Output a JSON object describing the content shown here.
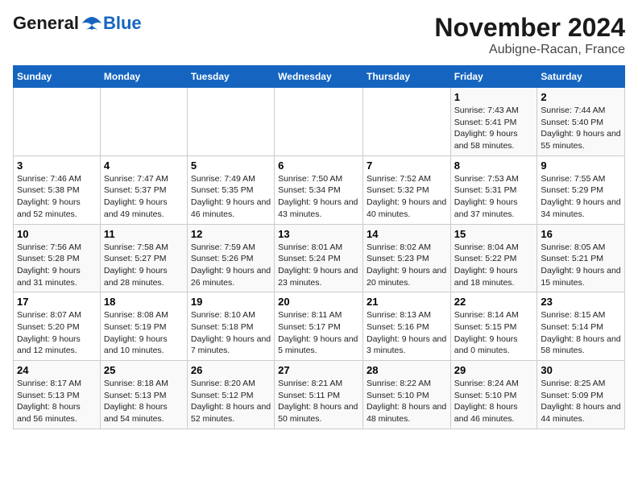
{
  "logo": {
    "general": "General",
    "blue": "Blue"
  },
  "title": "November 2024",
  "location": "Aubigne-Racan, France",
  "days_header": [
    "Sunday",
    "Monday",
    "Tuesday",
    "Wednesday",
    "Thursday",
    "Friday",
    "Saturday"
  ],
  "weeks": [
    [
      {
        "day": "",
        "info": ""
      },
      {
        "day": "",
        "info": ""
      },
      {
        "day": "",
        "info": ""
      },
      {
        "day": "",
        "info": ""
      },
      {
        "day": "",
        "info": ""
      },
      {
        "day": "1",
        "info": "Sunrise: 7:43 AM\nSunset: 5:41 PM\nDaylight: 9 hours and 58 minutes."
      },
      {
        "day": "2",
        "info": "Sunrise: 7:44 AM\nSunset: 5:40 PM\nDaylight: 9 hours and 55 minutes."
      }
    ],
    [
      {
        "day": "3",
        "info": "Sunrise: 7:46 AM\nSunset: 5:38 PM\nDaylight: 9 hours and 52 minutes."
      },
      {
        "day": "4",
        "info": "Sunrise: 7:47 AM\nSunset: 5:37 PM\nDaylight: 9 hours and 49 minutes."
      },
      {
        "day": "5",
        "info": "Sunrise: 7:49 AM\nSunset: 5:35 PM\nDaylight: 9 hours and 46 minutes."
      },
      {
        "day": "6",
        "info": "Sunrise: 7:50 AM\nSunset: 5:34 PM\nDaylight: 9 hours and 43 minutes."
      },
      {
        "day": "7",
        "info": "Sunrise: 7:52 AM\nSunset: 5:32 PM\nDaylight: 9 hours and 40 minutes."
      },
      {
        "day": "8",
        "info": "Sunrise: 7:53 AM\nSunset: 5:31 PM\nDaylight: 9 hours and 37 minutes."
      },
      {
        "day": "9",
        "info": "Sunrise: 7:55 AM\nSunset: 5:29 PM\nDaylight: 9 hours and 34 minutes."
      }
    ],
    [
      {
        "day": "10",
        "info": "Sunrise: 7:56 AM\nSunset: 5:28 PM\nDaylight: 9 hours and 31 minutes."
      },
      {
        "day": "11",
        "info": "Sunrise: 7:58 AM\nSunset: 5:27 PM\nDaylight: 9 hours and 28 minutes."
      },
      {
        "day": "12",
        "info": "Sunrise: 7:59 AM\nSunset: 5:26 PM\nDaylight: 9 hours and 26 minutes."
      },
      {
        "day": "13",
        "info": "Sunrise: 8:01 AM\nSunset: 5:24 PM\nDaylight: 9 hours and 23 minutes."
      },
      {
        "day": "14",
        "info": "Sunrise: 8:02 AM\nSunset: 5:23 PM\nDaylight: 9 hours and 20 minutes."
      },
      {
        "day": "15",
        "info": "Sunrise: 8:04 AM\nSunset: 5:22 PM\nDaylight: 9 hours and 18 minutes."
      },
      {
        "day": "16",
        "info": "Sunrise: 8:05 AM\nSunset: 5:21 PM\nDaylight: 9 hours and 15 minutes."
      }
    ],
    [
      {
        "day": "17",
        "info": "Sunrise: 8:07 AM\nSunset: 5:20 PM\nDaylight: 9 hours and 12 minutes."
      },
      {
        "day": "18",
        "info": "Sunrise: 8:08 AM\nSunset: 5:19 PM\nDaylight: 9 hours and 10 minutes."
      },
      {
        "day": "19",
        "info": "Sunrise: 8:10 AM\nSunset: 5:18 PM\nDaylight: 9 hours and 7 minutes."
      },
      {
        "day": "20",
        "info": "Sunrise: 8:11 AM\nSunset: 5:17 PM\nDaylight: 9 hours and 5 minutes."
      },
      {
        "day": "21",
        "info": "Sunrise: 8:13 AM\nSunset: 5:16 PM\nDaylight: 9 hours and 3 minutes."
      },
      {
        "day": "22",
        "info": "Sunrise: 8:14 AM\nSunset: 5:15 PM\nDaylight: 9 hours and 0 minutes."
      },
      {
        "day": "23",
        "info": "Sunrise: 8:15 AM\nSunset: 5:14 PM\nDaylight: 8 hours and 58 minutes."
      }
    ],
    [
      {
        "day": "24",
        "info": "Sunrise: 8:17 AM\nSunset: 5:13 PM\nDaylight: 8 hours and 56 minutes."
      },
      {
        "day": "25",
        "info": "Sunrise: 8:18 AM\nSunset: 5:13 PM\nDaylight: 8 hours and 54 minutes."
      },
      {
        "day": "26",
        "info": "Sunrise: 8:20 AM\nSunset: 5:12 PM\nDaylight: 8 hours and 52 minutes."
      },
      {
        "day": "27",
        "info": "Sunrise: 8:21 AM\nSunset: 5:11 PM\nDaylight: 8 hours and 50 minutes."
      },
      {
        "day": "28",
        "info": "Sunrise: 8:22 AM\nSunset: 5:10 PM\nDaylight: 8 hours and 48 minutes."
      },
      {
        "day": "29",
        "info": "Sunrise: 8:24 AM\nSunset: 5:10 PM\nDaylight: 8 hours and 46 minutes."
      },
      {
        "day": "30",
        "info": "Sunrise: 8:25 AM\nSunset: 5:09 PM\nDaylight: 8 hours and 44 minutes."
      }
    ]
  ]
}
